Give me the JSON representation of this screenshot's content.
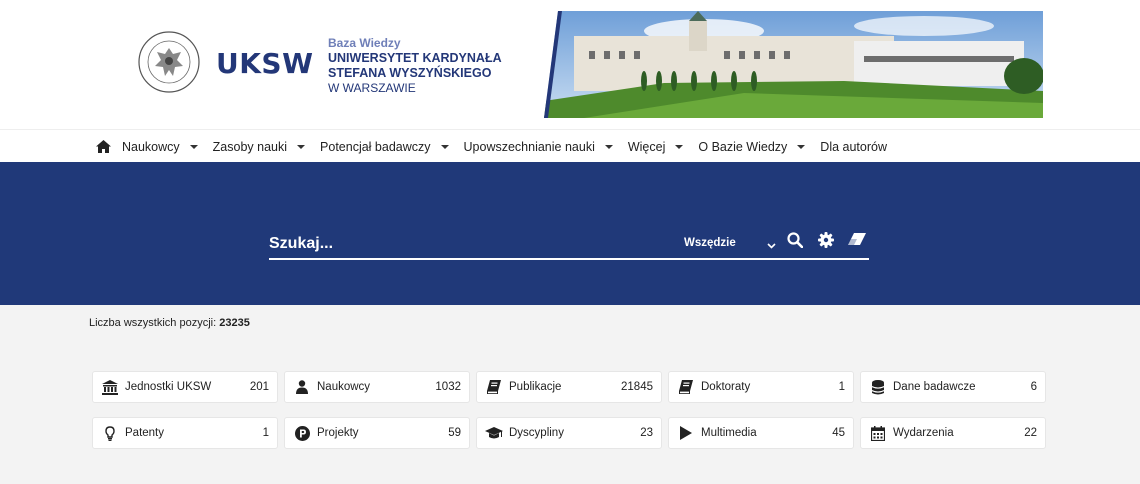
{
  "header": {
    "brand": "UKSW",
    "sub_line1": "Baza Wiedzy",
    "sub_line2": "UNIWERSYTET KARDYNAŁA",
    "sub_line3": "STEFANA WYSZYŃSKIEGO",
    "sub_line4": "W WARSZAWIE"
  },
  "nav": {
    "items": [
      {
        "label": "Naukowcy",
        "dropdown": true
      },
      {
        "label": "Zasoby nauki",
        "dropdown": true
      },
      {
        "label": "Potencjał badawczy",
        "dropdown": true
      },
      {
        "label": "Upowszechnianie nauki",
        "dropdown": true
      },
      {
        "label": "Więcej",
        "dropdown": true
      },
      {
        "label": "O Bazie Wiedzy",
        "dropdown": true
      },
      {
        "label": "Dla autorów",
        "dropdown": false
      }
    ]
  },
  "search": {
    "placeholder": "Szukaj...",
    "scope": "Wszędzie",
    "icons": [
      "search-icon",
      "gear-icon",
      "eraser-icon"
    ]
  },
  "summary": {
    "label": "Liczba wszystkich pozycji:",
    "total": "23235"
  },
  "categories": [
    {
      "icon": "university-icon",
      "label": "Jednostki UKSW",
      "count": "201"
    },
    {
      "icon": "user-icon",
      "label": "Naukowcy",
      "count": "1032"
    },
    {
      "icon": "book-icon",
      "label": "Publikacje",
      "count": "21845"
    },
    {
      "icon": "book-icon",
      "label": "Doktoraty",
      "count": "1"
    },
    {
      "icon": "database-icon",
      "label": "Dane badawcze",
      "count": "6"
    },
    {
      "icon": "lightbulb-icon",
      "label": "Patenty",
      "count": "1"
    },
    {
      "icon": "project-p-icon",
      "label": "Projekty",
      "count": "59"
    },
    {
      "icon": "graduation-cap-icon",
      "label": "Dyscypliny",
      "count": "23"
    },
    {
      "icon": "play-icon",
      "label": "Multimedia",
      "count": "45"
    },
    {
      "icon": "calendar-icon",
      "label": "Wydarzenia",
      "count": "22"
    }
  ],
  "colors": {
    "brand_navy": "#233778",
    "hero_bg": "#203979",
    "page_bg": "#f3f3f3"
  }
}
